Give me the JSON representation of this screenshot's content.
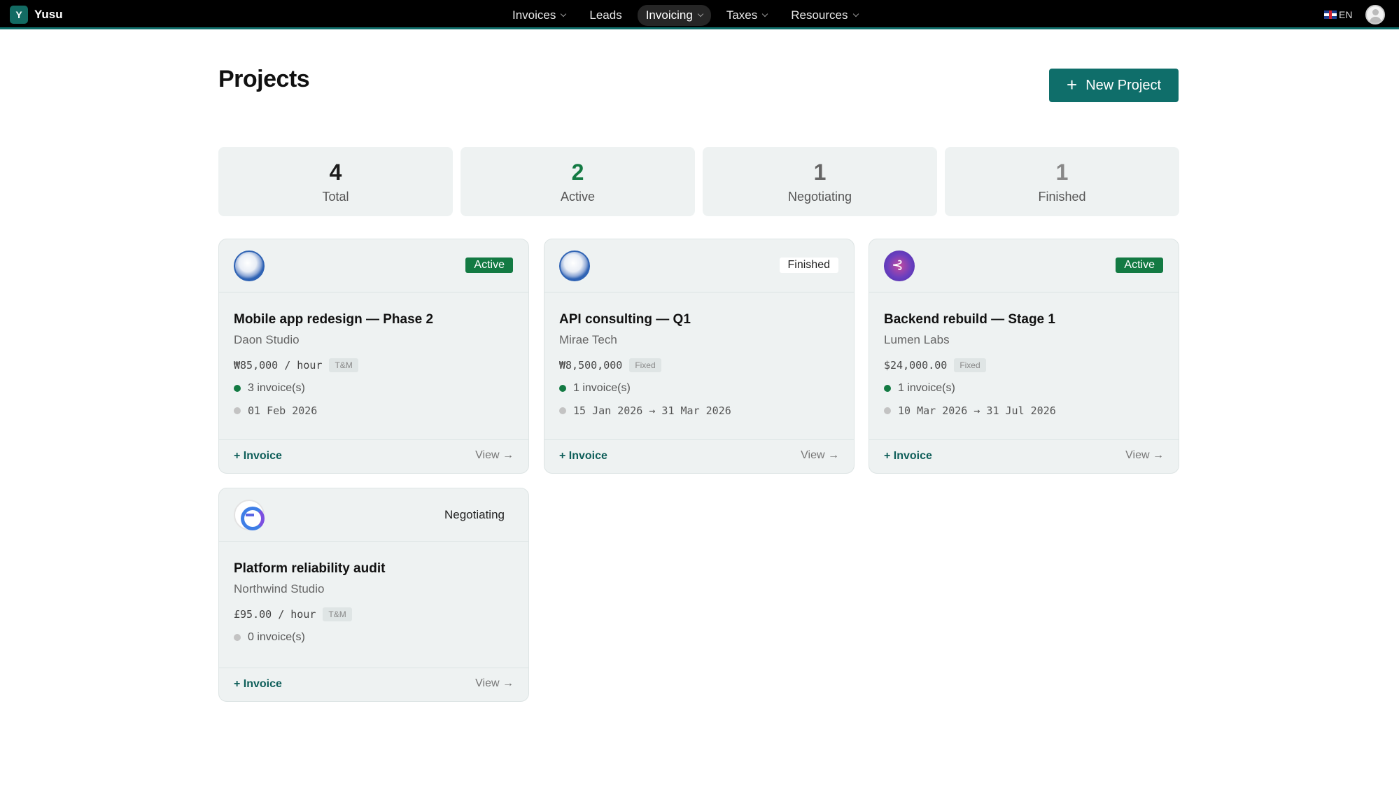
{
  "brand": {
    "logo_letter": "Y",
    "name": "Yusu"
  },
  "nav": {
    "items": [
      {
        "label": "Invoices",
        "has_chevron": true,
        "active": false
      },
      {
        "label": "Leads",
        "has_chevron": false,
        "active": false
      },
      {
        "label": "Invoicing",
        "has_chevron": true,
        "active": true
      },
      {
        "label": "Taxes",
        "has_chevron": true,
        "active": false
      },
      {
        "label": "Resources",
        "has_chevron": true,
        "active": false
      }
    ],
    "language": "EN",
    "flag_icon": "uk-flag-icon",
    "avatar_icon": "user-avatar-icon"
  },
  "page": {
    "title": "Projects",
    "new_button_label": "New Project",
    "new_button_icon": "plus-icon"
  },
  "stats": [
    {
      "value": "4",
      "label": "Total",
      "color": "#1c1c1c"
    },
    {
      "value": "2",
      "label": "Active",
      "color": "#137a43"
    },
    {
      "value": "1",
      "label": "Negotiating",
      "color": "#666666"
    },
    {
      "value": "1",
      "label": "Finished",
      "color": "#888888"
    }
  ],
  "projects": [
    {
      "logo": "globe-logo-icon",
      "status": "Active",
      "title": "Mobile app redesign — Phase 2",
      "client": "Daon Studio",
      "rate": "₩85,000 / hour",
      "billing_type": "T&M",
      "invoices": "3 invoice(s)",
      "dates": "01 Feb 2026",
      "invoice_link": "+ Invoice",
      "view_link": "View →"
    },
    {
      "logo": "globe-logo-icon",
      "status": "Finished",
      "title": "API consulting — Q1",
      "client": "Mirae Tech",
      "rate": "₩8,500,000",
      "billing_type": "Fixed",
      "invoices": "1 invoice(s)",
      "dates": "15 Jan 2026 → 31 Mar 2026",
      "invoice_link": "+ Invoice",
      "view_link": "View →"
    },
    {
      "logo": "lumen-logo-icon",
      "status": "Active",
      "title": "Backend rebuild — Stage 1",
      "client": "Lumen Labs",
      "rate": "$24,000.00",
      "billing_type": "Fixed",
      "invoices": "1 invoice(s)",
      "dates": "10 Mar 2026 → 31 Jul 2026",
      "invoice_link": "+ Invoice",
      "view_link": "View →"
    },
    {
      "logo": "northwind-logo-icon",
      "status": "Negotiating",
      "title": "Platform reliability audit",
      "client": "Northwind Studio",
      "rate": "£95.00 / hour",
      "billing_type": "T&M",
      "invoices": "0 invoice(s)",
      "invoice_link": "+ Invoice",
      "view_link": "View →"
    }
  ],
  "colors": {
    "brand": "#0f6e6a",
    "active": "#137a43",
    "card_bg": "#eef2f2"
  }
}
